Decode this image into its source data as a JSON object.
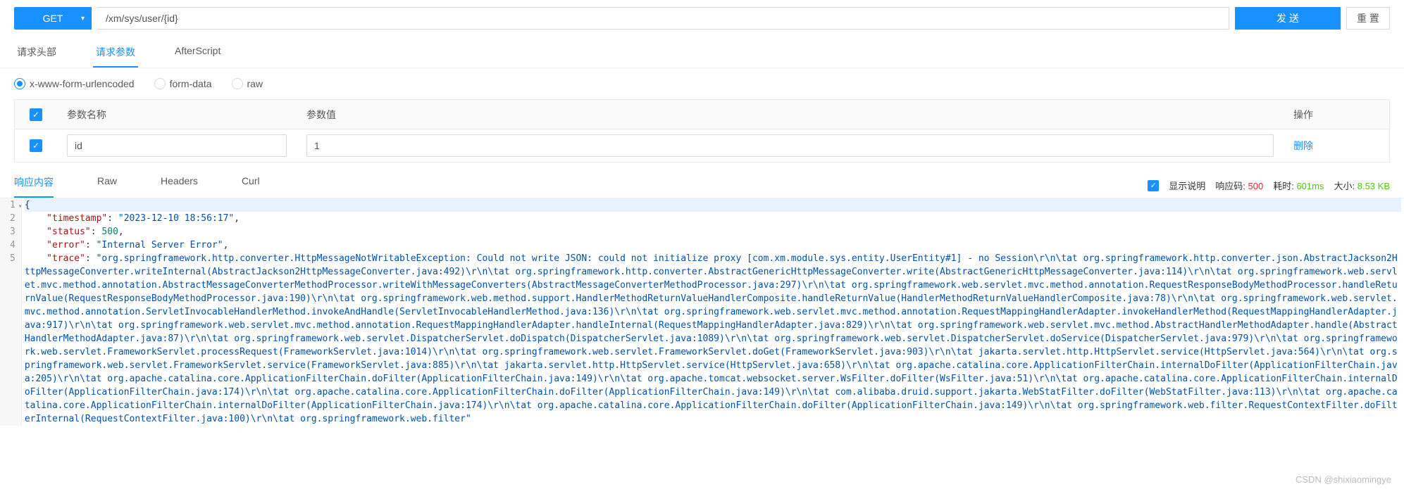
{
  "request": {
    "method": "GET",
    "url": "/xm/sys/user/{id}",
    "send_label": "发 送",
    "reset_label": "重 置"
  },
  "req_tabs": {
    "headers": "请求头部",
    "params": "请求参数",
    "after": "AfterScript"
  },
  "body_types": {
    "urlenc": "x-www-form-urlencoded",
    "formdata": "form-data",
    "raw": "raw"
  },
  "params_table": {
    "header_name": "参数名称",
    "header_value": "参数值",
    "header_action": "操作",
    "row": {
      "name": "id",
      "value": "1",
      "delete": "删除"
    }
  },
  "resp_tabs": {
    "content": "响应内容",
    "raw": "Raw",
    "headers": "Headers",
    "curl": "Curl"
  },
  "resp_meta": {
    "show_desc": "显示说明",
    "code_label": "响应码:",
    "code_value": "500",
    "time_label": "耗时:",
    "time_value": "601ms",
    "size_label": "大小:",
    "size_value": "8.53 KB"
  },
  "response_json": {
    "timestamp": "2023-12-10 18:56:17",
    "status": 500,
    "error": "Internal Server Error",
    "trace": "org.springframework.http.converter.HttpMessageNotWritableException: Could not write JSON: could not initialize proxy [com.xm.module.sys.entity.UserEntity#1] - no Session\\r\\n\\tat org.springframework.http.converter.json.AbstractJackson2HttpMessageConverter.writeInternal(AbstractJackson2HttpMessageConverter.java:492)\\r\\n\\tat org.springframework.http.converter.AbstractGenericHttpMessageConverter.write(AbstractGenericHttpMessageConverter.java:114)\\r\\n\\tat org.springframework.web.servlet.mvc.method.annotation.AbstractMessageConverterMethodProcessor.writeWithMessageConverters(AbstractMessageConverterMethodProcessor.java:297)\\r\\n\\tat org.springframework.web.servlet.mvc.method.annotation.RequestResponseBodyMethodProcessor.handleReturnValue(RequestResponseBodyMethodProcessor.java:190)\\r\\n\\tat org.springframework.web.method.support.HandlerMethodReturnValueHandlerComposite.handleReturnValue(HandlerMethodReturnValueHandlerComposite.java:78)\\r\\n\\tat org.springframework.web.servlet.mvc.method.annotation.ServletInvocableHandlerMethod.invokeAndHandle(ServletInvocableHandlerMethod.java:136)\\r\\n\\tat org.springframework.web.servlet.mvc.method.annotation.RequestMappingHandlerAdapter.invokeHandlerMethod(RequestMappingHandlerAdapter.java:917)\\r\\n\\tat org.springframework.web.servlet.mvc.method.annotation.RequestMappingHandlerAdapter.handleInternal(RequestMappingHandlerAdapter.java:829)\\r\\n\\tat org.springframework.web.servlet.mvc.method.AbstractHandlerMethodAdapter.handle(AbstractHandlerMethodAdapter.java:87)\\r\\n\\tat org.springframework.web.servlet.DispatcherServlet.doDispatch(DispatcherServlet.java:1089)\\r\\n\\tat org.springframework.web.servlet.DispatcherServlet.doService(DispatcherServlet.java:979)\\r\\n\\tat org.springframework.web.servlet.FrameworkServlet.processRequest(FrameworkServlet.java:1014)\\r\\n\\tat org.springframework.web.servlet.FrameworkServlet.doGet(FrameworkServlet.java:903)\\r\\n\\tat jakarta.servlet.http.HttpServlet.service(HttpServlet.java:564)\\r\\n\\tat org.springframework.web.servlet.FrameworkServlet.service(FrameworkServlet.java:885)\\r\\n\\tat jakarta.servlet.http.HttpServlet.service(HttpServlet.java:658)\\r\\n\\tat org.apache.catalina.core.ApplicationFilterChain.internalDoFilter(ApplicationFilterChain.java:205)\\r\\n\\tat org.apache.catalina.core.ApplicationFilterChain.doFilter(ApplicationFilterChain.java:149)\\r\\n\\tat org.apache.tomcat.websocket.server.WsFilter.doFilter(WsFilter.java:51)\\r\\n\\tat org.apache.catalina.core.ApplicationFilterChain.internalDoFilter(ApplicationFilterChain.java:174)\\r\\n\\tat org.apache.catalina.core.ApplicationFilterChain.doFilter(ApplicationFilterChain.java:149)\\r\\n\\tat com.alibaba.druid.support.jakarta.WebStatFilter.doFilter(WebStatFilter.java:113)\\r\\n\\tat org.apache.catalina.core.ApplicationFilterChain.internalDoFilter(ApplicationFilterChain.java:174)\\r\\n\\tat org.apache.catalina.core.ApplicationFilterChain.doFilter(ApplicationFilterChain.java:149)\\r\\n\\tat org.springframework.web.filter.RequestContextFilter.doFilterInternal(RequestContextFilter.java:100)\\r\\n\\tat org.springframework.web.filter"
  },
  "watermark": "CSDN @shixiaomingye"
}
